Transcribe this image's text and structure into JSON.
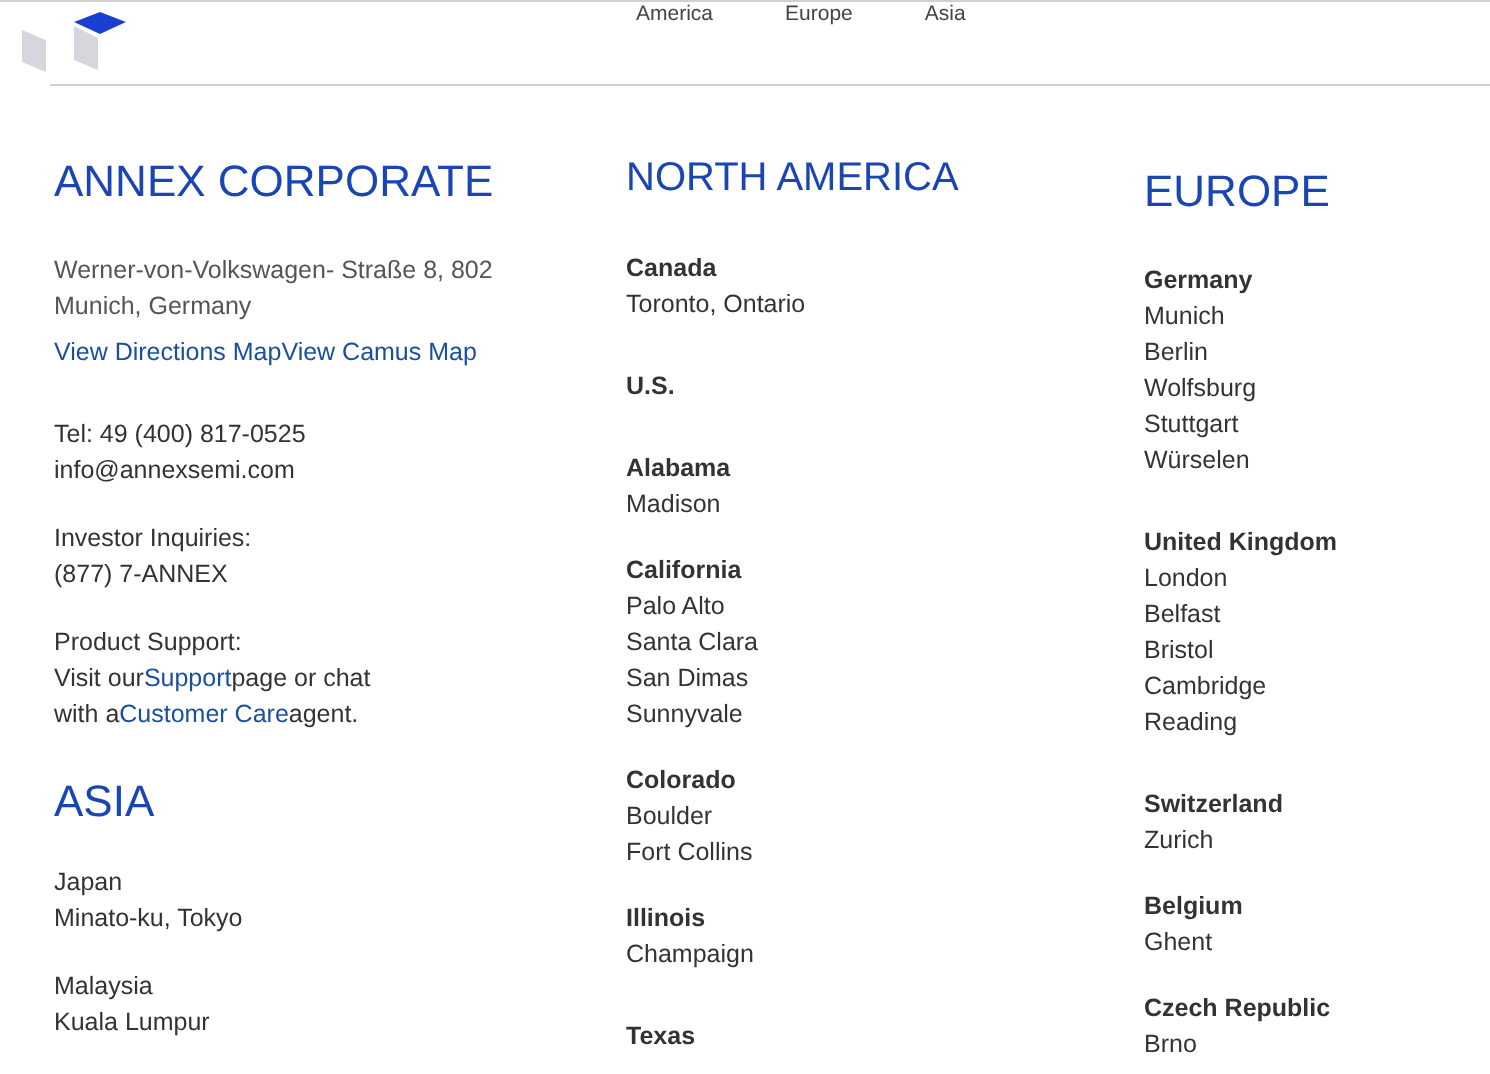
{
  "nav": {
    "links": [
      "America",
      "Europe",
      "Asia"
    ]
  },
  "corporate": {
    "heading": "ANNEX CORPORATE",
    "address": [
      "Werner-von-Volkswagen- Straße 8, 802",
      "Munich, Germany"
    ],
    "map_links": [
      "View Directions Map",
      "View Camus Map"
    ],
    "contact": [
      "Tel: 49 (400) 817-0525",
      "info@annexsemi.com"
    ],
    "investor": [
      "Investor Inquiries:",
      "(877) 7-ANNEX"
    ],
    "support": {
      "label": "Product Support:",
      "line_1_before": "Visit our",
      "link_1": "Support",
      "line_1_after": "page or chat",
      "line_2_before": "with a",
      "link_2": "Customer Care",
      "line_2_after": "agent."
    }
  },
  "asia": {
    "heading": "ASIA",
    "offices": [
      {
        "country": "Japan",
        "city": "Minato-ku, Tokyo"
      },
      {
        "country": "Malaysia",
        "city": "Kuala Lumpur"
      }
    ]
  },
  "north_america": {
    "heading": "NORTH AMERICA",
    "groups": [
      {
        "kind": "country",
        "name": "Canada",
        "cities": [
          "Toronto, Ontario"
        ]
      },
      {
        "kind": "country",
        "name": "U.S."
      },
      {
        "kind": "state",
        "name": "Alabama",
        "cities": [
          "Madison"
        ]
      },
      {
        "kind": "state",
        "name": "California",
        "cities": [
          "Palo Alto",
          "Santa Clara",
          "San Dimas",
          "Sunnyvale"
        ]
      },
      {
        "kind": "state",
        "name": "Colorado",
        "cities": [
          "Boulder",
          "Fort Collins"
        ]
      },
      {
        "kind": "country",
        "name": "Illinois",
        "cities": [
          "Champaign"
        ]
      },
      {
        "kind": "country",
        "name": "Texas"
      }
    ]
  },
  "europe": {
    "heading": "EUROPE",
    "groups": [
      {
        "kind": "country",
        "name": "Germany",
        "cities": [
          "Munich",
          "Berlin",
          "Wolfsburg",
          "Stuttgart",
          "Würselen"
        ]
      },
      {
        "kind": "country",
        "name": "United Kingdom",
        "cities": [
          "London",
          "Belfast",
          "Bristol",
          "Cambridge",
          "Reading"
        ]
      },
      {
        "kind": "state",
        "name": "Switzerland",
        "cities": [
          "Zurich"
        ]
      },
      {
        "kind": "state",
        "name": "Belgium",
        "cities": [
          "Ghent"
        ]
      },
      {
        "kind": "state",
        "name": "Czech Republic",
        "cities": [
          "Brno"
        ]
      }
    ]
  }
}
